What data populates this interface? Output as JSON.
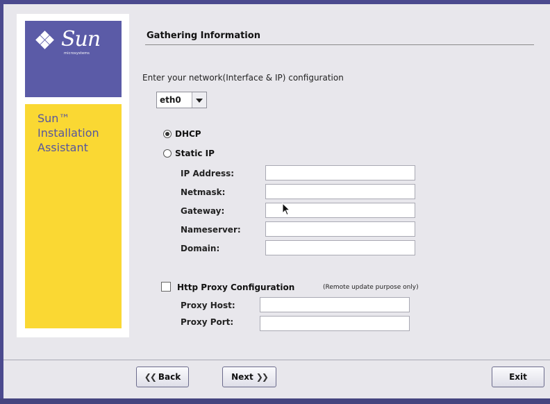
{
  "sidebar": {
    "brand_name": "Sun",
    "brand_sub": "microsystems",
    "product_line1": "Sun™",
    "product_line2": "Installation",
    "product_line3": "Assistant"
  },
  "page": {
    "title": "Gathering Information",
    "prompt": "Enter your network(Interface & IP) configuration"
  },
  "interface_select": {
    "value": "eth0"
  },
  "network": {
    "dhcp_label": "DHCP",
    "dhcp_selected": true,
    "static_label": "Static IP",
    "static_selected": false,
    "fields": {
      "ip_label": "IP Address:",
      "netmask_label": "Netmask:",
      "gateway_label": "Gateway:",
      "nameserver_label": "Nameserver:",
      "domain_label": "Domain:",
      "ip_value": "",
      "netmask_value": "",
      "gateway_value": "",
      "nameserver_value": "",
      "domain_value": ""
    }
  },
  "proxy": {
    "checkbox_label": "Http Proxy Configuration",
    "note": "(Remote update purpose only)",
    "checked": false,
    "host_label": "Proxy Host:",
    "port_label": "Proxy Port:",
    "host_value": "",
    "port_value": ""
  },
  "buttons": {
    "back_label": "Back",
    "next_label": "Next",
    "exit_label": "Exit"
  },
  "colors": {
    "brand_purple": "#5b5ba7",
    "brand_yellow": "#fad833",
    "window_border": "#4b4a8e"
  },
  "icons": {
    "back": "double-chevron-left-icon",
    "next": "double-chevron-right-icon",
    "dropdown": "triangle-down-icon",
    "logo": "sun-diamond-logo-icon"
  }
}
